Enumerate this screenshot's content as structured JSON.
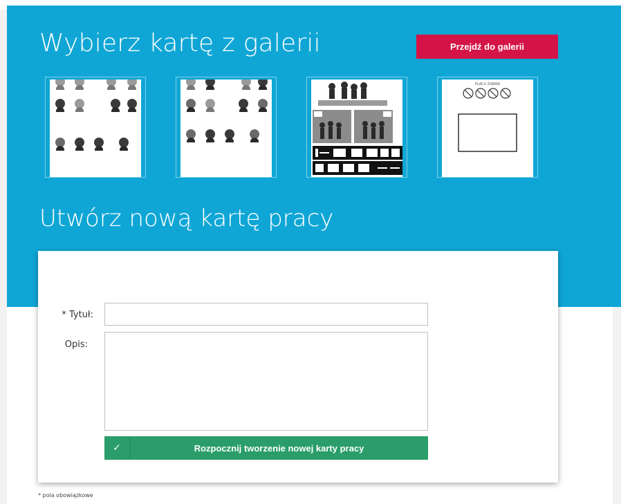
{
  "gallery": {
    "title": "Wybierz kartę z galerii",
    "button_label": "Przejdź do galerii",
    "thumbnails": [
      {
        "name": "faces-sheet-1"
      },
      {
        "name": "faces-sheet-2"
      },
      {
        "name": "evacuation-signs-sheet"
      },
      {
        "name": "playground-rules-sheet",
        "caption": "PLACU ZABAW"
      }
    ]
  },
  "create": {
    "title": "Utwórz nową kartę pracy",
    "title_label": "* Tytuł:",
    "title_value": "",
    "description_label": "Opis:",
    "description_value": "",
    "submit_label": "Rozpocznij tworzenie nowej karty pracy"
  },
  "footer": {
    "required_note": "* pola obowiązkowe"
  },
  "colors": {
    "band": "#0fa6d6",
    "gallery_button": "#d41446",
    "submit_button": "#2a9d6a"
  }
}
